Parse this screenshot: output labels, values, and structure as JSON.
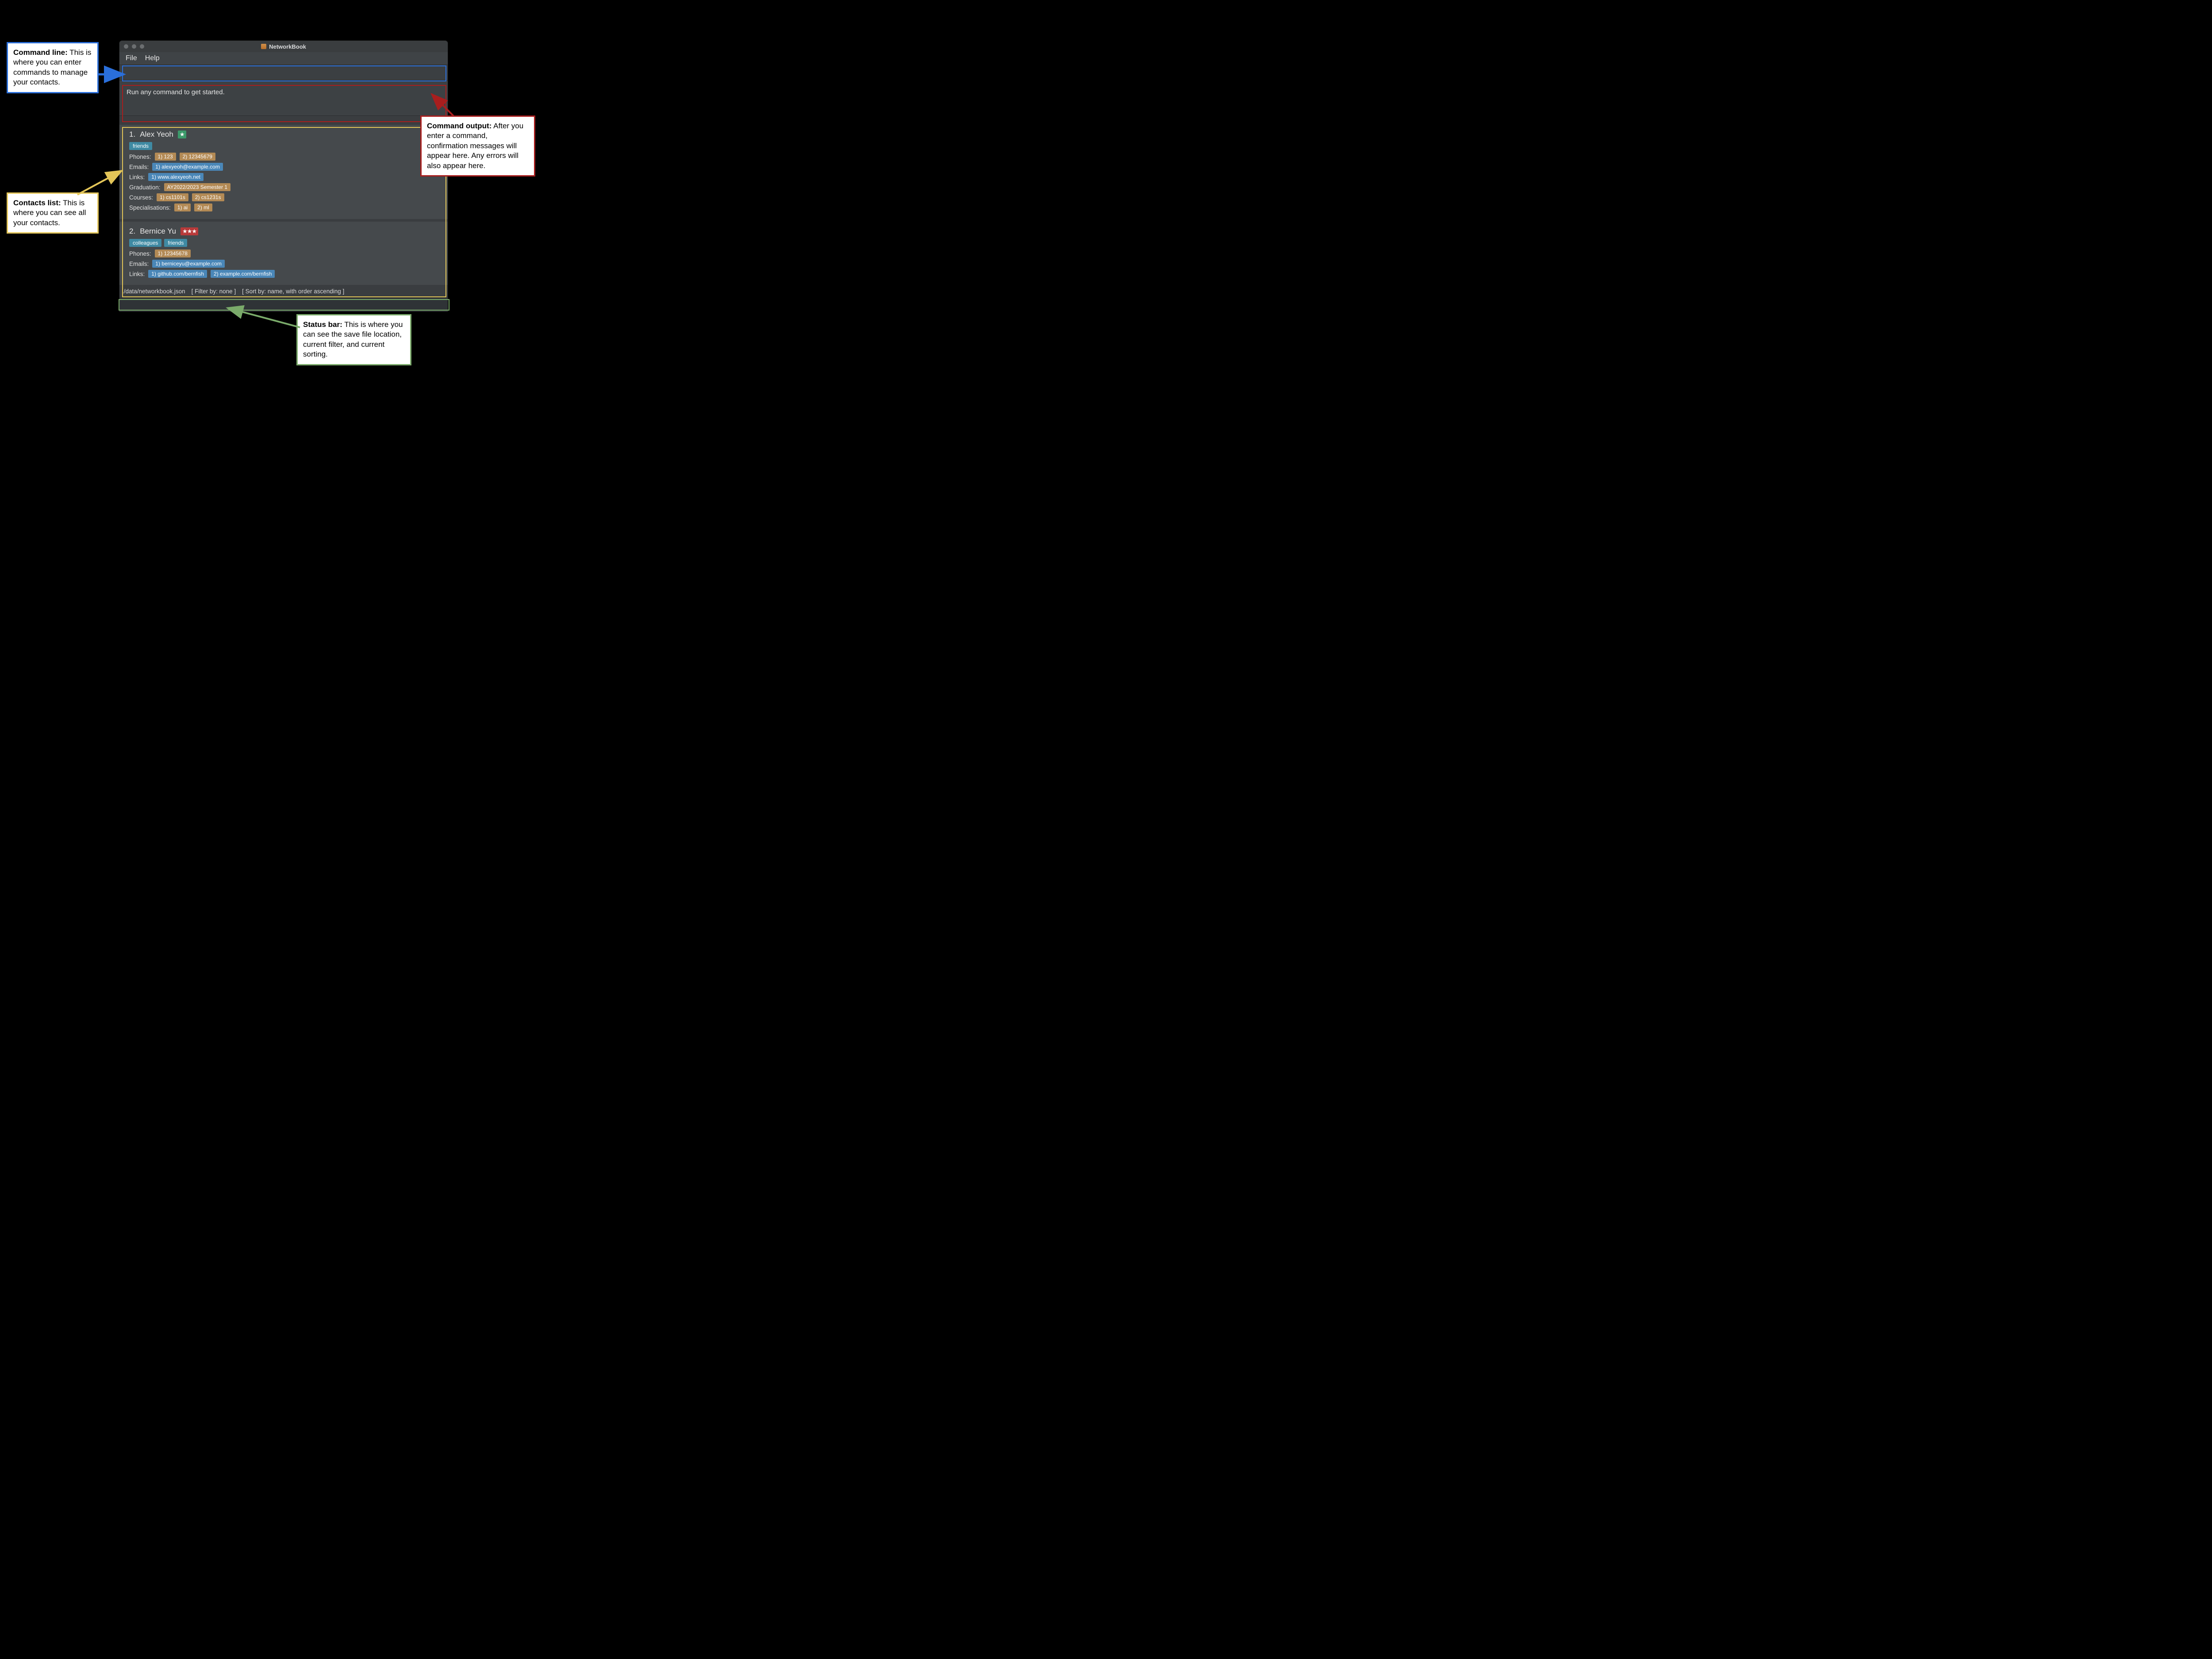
{
  "window": {
    "title": "NetworkBook",
    "menu": {
      "file": "File",
      "help": "Help"
    }
  },
  "cmd_input": {
    "value": ""
  },
  "cmd_output": {
    "message": "Run any command to get started."
  },
  "labels": {
    "phones": "Phones:",
    "emails": "Emails:",
    "links": "Links:",
    "graduation": "Graduation:",
    "courses": "Courses:",
    "specialisations": "Specialisations:"
  },
  "contacts": [
    {
      "index": "1.",
      "name": "Alex Yeoh",
      "stars": 1,
      "star_style": "green",
      "tags": [
        "friends"
      ],
      "phones": [
        "1) 123",
        "2) 12345679"
      ],
      "emails": [
        "1) alexyeoh@example.com"
      ],
      "links": [
        "1) www.alexyeoh.net"
      ],
      "graduation": "AY2022/2023 Semester 1",
      "courses": [
        "1) cs1101s",
        "2) cs1231s"
      ],
      "specialisations": [
        "1) ai",
        "2) ml"
      ]
    },
    {
      "index": "2.",
      "name": "Bernice Yu",
      "stars": 3,
      "star_style": "red",
      "tags": [
        "colleagues",
        "friends"
      ],
      "phones": [
        "1) 12345678"
      ],
      "emails": [
        "1) berniceyu@example.com"
      ],
      "links": [
        "1) github.com/bernfish",
        "2) example.com/bernfish"
      ]
    }
  ],
  "status": {
    "path": "./data/networkbook.json",
    "filter": "[ Filter by: none ]",
    "sort": "[ Sort by: name, with order ascending ]"
  },
  "callouts": {
    "cmdline": {
      "title": "Command line:",
      "body": "This is where you can enter commands to manage your contacts."
    },
    "output": {
      "title": "Command output:",
      "body": "After you enter a command, confirmation messages will appear here. Any errors will also appear here."
    },
    "contacts": {
      "title": "Contacts list:",
      "body": "This is where you can see all your contacts."
    },
    "status": {
      "title": "Status bar:",
      "body": "This is where you can see the save file location, current filter, and current sorting."
    }
  }
}
